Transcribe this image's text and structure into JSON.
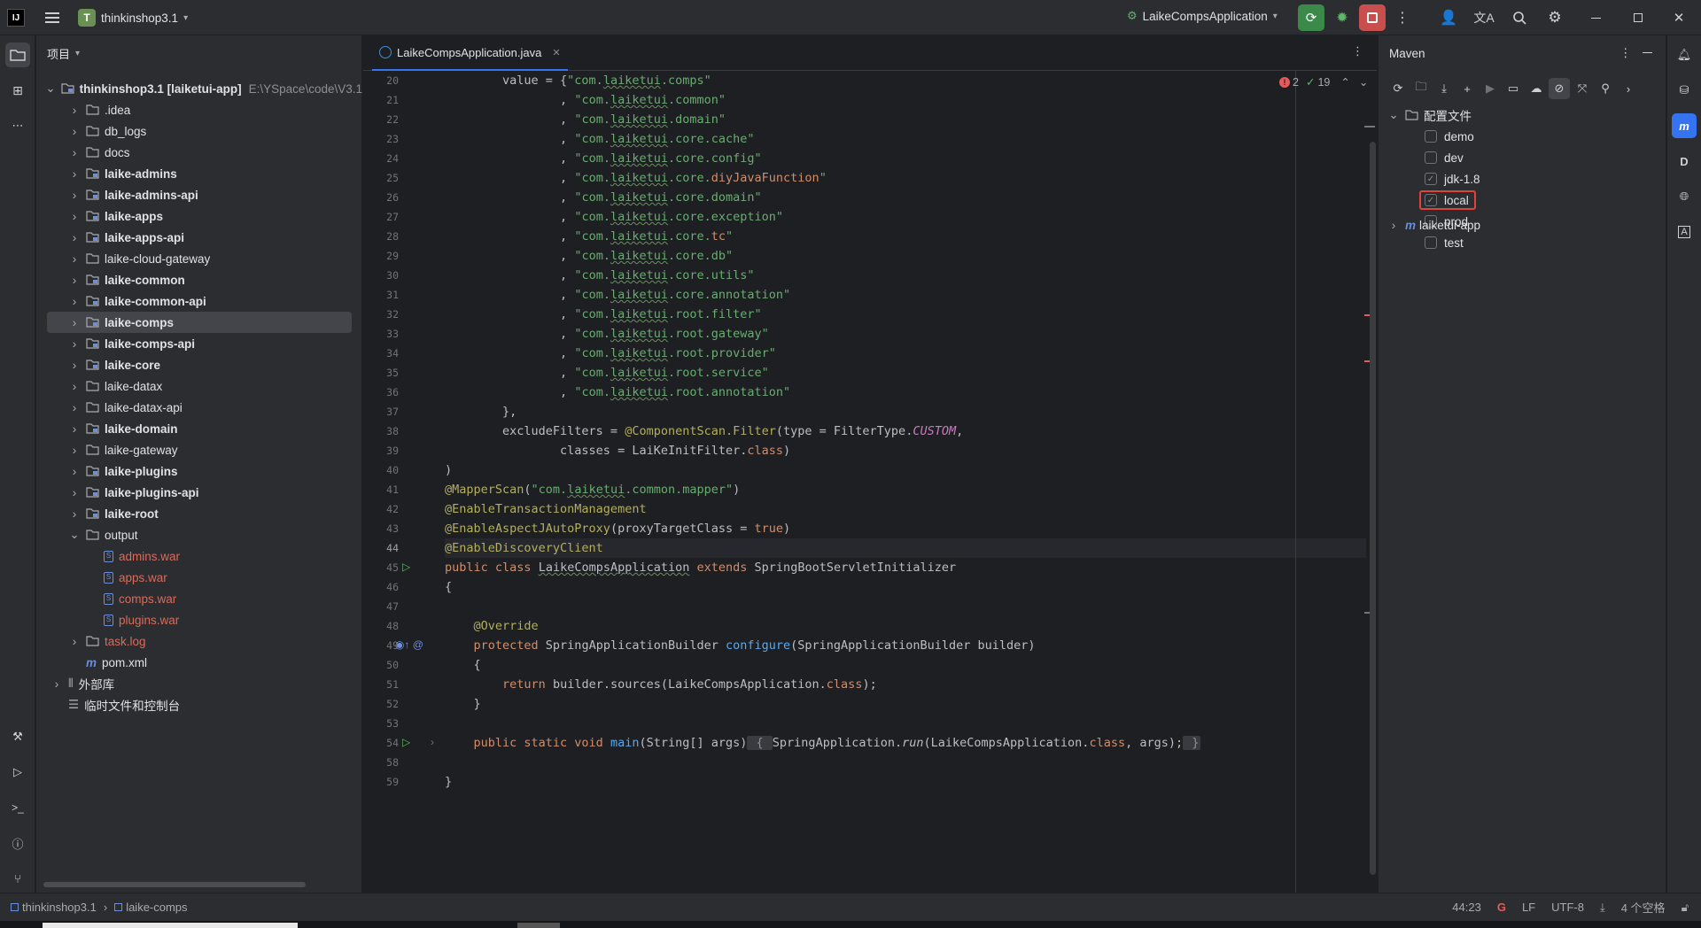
{
  "titlebar": {
    "project_badge": "T",
    "project_name": "thinkinshop3.1",
    "run_config": "LaikeCompsApplication"
  },
  "project_panel": {
    "title": "项目",
    "root_name": "thinkinshop3.1 [laiketui-app]",
    "root_path": "E:\\YSpace\\code\\V3.1",
    "items": [
      {
        "label": ".idea",
        "bold": false,
        "red": false
      },
      {
        "label": "db_logs",
        "bold": false,
        "red": false
      },
      {
        "label": "docs",
        "bold": false,
        "red": false
      },
      {
        "label": "laike-admins",
        "bold": true,
        "red": false
      },
      {
        "label": "laike-admins-api",
        "bold": true,
        "red": false
      },
      {
        "label": "laike-apps",
        "bold": true,
        "red": false
      },
      {
        "label": "laike-apps-api",
        "bold": true,
        "red": false
      },
      {
        "label": "laike-cloud-gateway",
        "bold": false,
        "red": false
      },
      {
        "label": "laike-common",
        "bold": true,
        "red": false
      },
      {
        "label": "laike-common-api",
        "bold": true,
        "red": false
      },
      {
        "label": "laike-comps",
        "bold": true,
        "red": false
      },
      {
        "label": "laike-comps-api",
        "bold": true,
        "red": false
      },
      {
        "label": "laike-core",
        "bold": true,
        "red": false
      },
      {
        "label": "laike-datax",
        "bold": false,
        "red": false
      },
      {
        "label": "laike-datax-api",
        "bold": false,
        "red": false
      },
      {
        "label": "laike-domain",
        "bold": true,
        "red": false
      },
      {
        "label": "laike-gateway",
        "bold": false,
        "red": false
      },
      {
        "label": "laike-plugins",
        "bold": true,
        "red": false
      },
      {
        "label": "laike-plugins-api",
        "bold": true,
        "red": false
      },
      {
        "label": "laike-root",
        "bold": true,
        "red": false
      },
      {
        "label": "output",
        "bold": false,
        "red": false
      }
    ],
    "output_files": [
      "admins.war",
      "apps.war",
      "comps.war",
      "plugins.war"
    ],
    "task_log": "task.log",
    "pom": "pom.xml",
    "external_libs": "外部库",
    "scratches": "临时文件和控制台"
  },
  "editor": {
    "tab_label": "LaikeCompsApplication.java",
    "errors": "2",
    "warnings": "19",
    "lines": [
      {
        "n": "20",
        "html": "        value = {<span class='str'>\"com.<span class='und'>laiketui</span>.comps\"</span>"
      },
      {
        "n": "21",
        "html": "                , <span class='str'>\"com.<span class='und'>laiketui</span>.common\"</span>"
      },
      {
        "n": "22",
        "html": "                , <span class='str'>\"com.<span class='und'>laiketui</span>.domain\"</span>"
      },
      {
        "n": "23",
        "html": "                , <span class='str'>\"com.<span class='und'>laiketui</span>.core.cache\"</span>"
      },
      {
        "n": "24",
        "html": "                , <span class='str'>\"com.<span class='und'>laiketui</span>.core.config\"</span>"
      },
      {
        "n": "25",
        "html": "                , <span class='str'>\"com.<span class='und'>laiketui</span>.core.</span><span class='kw'>diyJavaFunction</span><span class='str'>\"</span>"
      },
      {
        "n": "26",
        "html": "                , <span class='str'>\"com.<span class='und'>laiketui</span>.core.domain\"</span>"
      },
      {
        "n": "27",
        "html": "                , <span class='str'>\"com.<span class='und'>laiketui</span>.core.exception\"</span>"
      },
      {
        "n": "28",
        "html": "                , <span class='str'>\"com.<span class='und'>laiketui</span>.core.</span><span class='kw'>tc</span><span class='str'>\"</span>"
      },
      {
        "n": "29",
        "html": "                , <span class='str'>\"com.<span class='und'>laiketui</span>.core.db\"</span>"
      },
      {
        "n": "30",
        "html": "                , <span class='str'>\"com.<span class='und'>laiketui</span>.core.utils\"</span>"
      },
      {
        "n": "31",
        "html": "                , <span class='str'>\"com.<span class='und'>laiketui</span>.core.annotation\"</span>"
      },
      {
        "n": "32",
        "html": "                , <span class='str'>\"com.<span class='und'>laiketui</span>.root.filter\"</span>"
      },
      {
        "n": "33",
        "html": "                , <span class='str'>\"com.<span class='und'>laiketui</span>.root.gateway\"</span>"
      },
      {
        "n": "34",
        "html": "                , <span class='str'>\"com.<span class='und'>laiketui</span>.root.provider\"</span>"
      },
      {
        "n": "35",
        "html": "                , <span class='str'>\"com.<span class='und'>laiketui</span>.root.service\"</span>"
      },
      {
        "n": "36",
        "html": "                , <span class='str'>\"com.<span class='und'>laiketui</span>.root.annotation\"</span>"
      },
      {
        "n": "37",
        "html": "        },"
      },
      {
        "n": "38",
        "html": "        excludeFilters = <span class='ann'>@ComponentScan.Filter</span>(type = FilterType.<span class='ital'>CUSTOM</span>,"
      },
      {
        "n": "39",
        "html": "                classes = LaiKeInitFilter.<span class='kw'>class</span>)"
      },
      {
        "n": "40",
        "html": ")"
      },
      {
        "n": "41",
        "html": "<span class='ann'>@MapperScan</span>(<span class='str'>\"com.<span class='und'>laiketui</span>.common.mapper\"</span>)"
      },
      {
        "n": "42",
        "html": "<span class='ann'>@EnableTransactionManagement</span>"
      },
      {
        "n": "43",
        "html": "<span class='ann'>@EnableAspectJAutoProxy</span>(proxyTargetClass = <span class='kw'>true</span>)"
      },
      {
        "n": "44",
        "html": "<span class='ann'>@EnableDiscoveryClient</span>"
      },
      {
        "n": "45",
        "html": "<span class='kw'>public class</span> <span class='und'>LaikeCompsApplication</span> <span class='kw'>extends</span> SpringBootServletInitializer"
      },
      {
        "n": "46",
        "html": "{"
      },
      {
        "n": "47",
        "html": ""
      },
      {
        "n": "48",
        "html": "    <span class='ann'>@Override</span>"
      },
      {
        "n": "49",
        "html": "    <span class='kw'>protected</span> SpringApplicationBuilder <span class='fn'>configure</span>(SpringApplicationBuilder builder)"
      },
      {
        "n": "50",
        "html": "    {"
      },
      {
        "n": "51",
        "html": "        <span class='kw'>return</span> builder.sources(LaikeCompsApplication.<span class='kw'>class</span>);"
      },
      {
        "n": "52",
        "html": "    }"
      },
      {
        "n": "53",
        "html": ""
      },
      {
        "n": "54",
        "html": "    <span class='kw'>public static void</span> <span class='fn'>main</span>(String[] args)<span class='fold-box'> { </span>SpringApplication.<span class='stat'>run</span>(LaikeCompsApplication.<span class='kw'>class</span>, args);<span class='fold-box'> }</span>"
      },
      {
        "n": "58",
        "html": ""
      },
      {
        "n": "59",
        "html": "}"
      }
    ]
  },
  "maven": {
    "title": "Maven",
    "profiles_label": "配置文件",
    "profiles": [
      {
        "name": "demo",
        "checked": false
      },
      {
        "name": "dev",
        "checked": false
      },
      {
        "name": "jdk-1.8",
        "checked": true
      },
      {
        "name": "local",
        "checked": true
      },
      {
        "name": "prod",
        "checked": false
      },
      {
        "name": "test",
        "checked": false
      }
    ],
    "project": "laiketui-app"
  },
  "statusbar": {
    "crumb1": "thinkinshop3.1",
    "crumb2": "laike-comps",
    "position": "44:23",
    "line_sep": "LF",
    "encoding": "UTF-8",
    "indent": "4 个空格"
  }
}
